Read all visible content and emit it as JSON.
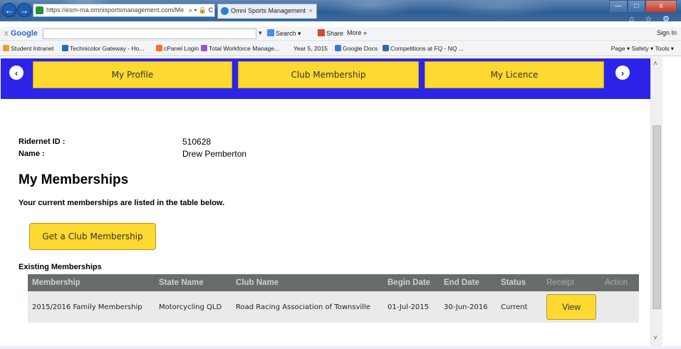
{
  "browser": {
    "url": "https://esm-ma.omnisportsmanagement.com/Me",
    "tab_title": "Omni Sports Management",
    "tab_close": "×",
    "back": "←",
    "forward": "→",
    "addr_controls": "⌕ ▾ 🔒 C",
    "window_min": "—",
    "window_max": "□",
    "window_close": "x",
    "chrome_icons": "⌂ ☆ ⚙",
    "google_close": "x",
    "google_logo": "Google",
    "google_search": "Search",
    "google_share": "Share",
    "google_more": "More »",
    "google_signin": "Sign In",
    "favorites": [
      "Student Intranet",
      "Technicolor Gateway - Ho...",
      "cPanel Login",
      "Total Workforce Manage...",
      "Year 5, 2015",
      "Google Docs",
      "Competitions at FQ - NQ ..."
    ],
    "command_bar": "Page ▾  Safety ▾  Tools ▾"
  },
  "nav": {
    "prev_icon": "chevron-left",
    "next_icon": "chevron-right",
    "prev_glyph": "‹",
    "next_glyph": "›",
    "items": [
      "My Profile",
      "Club Membership",
      "My Licence"
    ]
  },
  "profile": {
    "ridernet_label": "Ridernet ID :",
    "ridernet_value": "510628",
    "name_label": "Name :",
    "name_value": "Drew Pemberton"
  },
  "main": {
    "title": "My Memberships",
    "intro": "Your current memberships are listed in the table below.",
    "get_button": "Get a Club Membership",
    "existing_title": "Existing Memberships"
  },
  "table": {
    "headers": [
      "Membership",
      "State Name",
      "Club Name",
      "Begin Date",
      "End Date",
      "Status",
      "Receipt",
      "Action"
    ],
    "rows": [
      {
        "membership": "2015/2016 Family Membership",
        "state": "Motorcycling QLD",
        "club": "Road Racing Association of Townsville",
        "begin": "01-Jul-2015",
        "end": "30-Jun-2016",
        "status": "Current",
        "receipt_button": "View"
      }
    ]
  },
  "colors": {
    "nav_band": "#2d24ea",
    "button_yellow": "#fdd931",
    "table_header": "#686d6b",
    "table_row": "#e9ebea"
  }
}
